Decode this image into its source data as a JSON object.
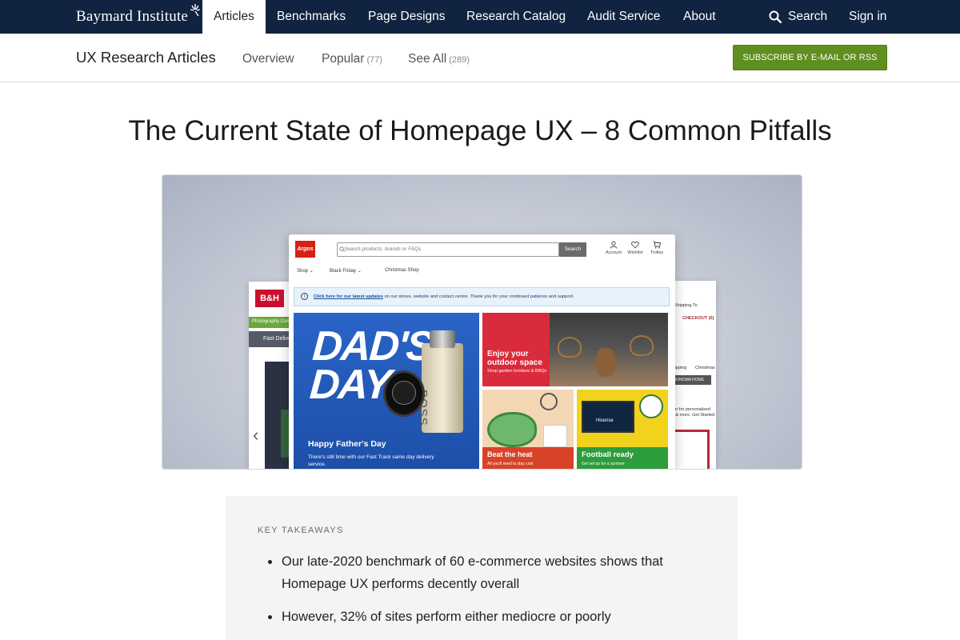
{
  "topnav": {
    "logo": "Baymard Institute",
    "items": [
      "Articles",
      "Benchmarks",
      "Page Designs",
      "Research Catalog",
      "Audit Service",
      "About"
    ],
    "active_item": "Articles",
    "search_label": "Search",
    "signin_label": "Sign in"
  },
  "subnav": {
    "title": "UX Research Articles",
    "links": [
      {
        "label": "Overview",
        "count": ""
      },
      {
        "label": "Popular",
        "count": "(77)"
      },
      {
        "label": "See All",
        "count": "(289)"
      }
    ],
    "subscribe_label": "SUBSCRIBE BY E-MAIL OR RSS"
  },
  "article": {
    "title": "The Current State of Homepage UX – 8 Common Pitfalls"
  },
  "hero": {
    "argos": {
      "logo": "Argos",
      "search_placeholder": "Search products, brands or FAQs",
      "search_button": "Search",
      "icons": [
        {
          "name": "account-icon",
          "label": "Account"
        },
        {
          "name": "heart-icon",
          "label": "Wishlist"
        },
        {
          "name": "trolley-icon",
          "label": "Trolley"
        }
      ],
      "menu": [
        "Shop",
        "Black Friday",
        "Christmas Shop"
      ],
      "notice_link": "Click here for our latest updates",
      "notice_text": "on our stores, website and contact centre. Thank you for your continued patience and support.",
      "banner_main_title": "DAD'S DAY",
      "banner_main_sub": "Happy Father's Day",
      "banner_main_sub2": "There's still time with our Fast Track same day delivery service.",
      "bottle_text": "BOSS",
      "outdoor_title": "Enjoy your outdoor space",
      "outdoor_sub": "Shop garden furniture & BBQs",
      "heat_title": "Beat the heat",
      "heat_sub": "All you'll need to stay cool",
      "football_title": "Football ready",
      "football_sub": "Get set up for a summer",
      "football_brand": "Hisense"
    },
    "bh": {
      "logo": "B&H",
      "nav_text": "Photography  Comp",
      "bar_text": "Fast Delive"
    },
    "ws": {
      "shipping": "Shipping To",
      "checkout": "CHECKOUT (0)",
      "shopping": "Shopping",
      "christmas": "Christmas",
      "bar": "S SONOMA HOME",
      "note1": "ister for personalized",
      "note2": "ce & more.  Get Started"
    }
  },
  "takeaways": {
    "heading": "KEY TAKEAWAYS",
    "items": [
      "Our late-2020 benchmark of 60 e-commerce websites shows that Homepage UX performs decently overall",
      "However, 32% of sites perform either mediocre or poorly"
    ]
  },
  "colors": {
    "nav_bg": "#102340",
    "subscribe_green": "#5f8f1f",
    "takeaways_bg": "#f4f4f4"
  }
}
